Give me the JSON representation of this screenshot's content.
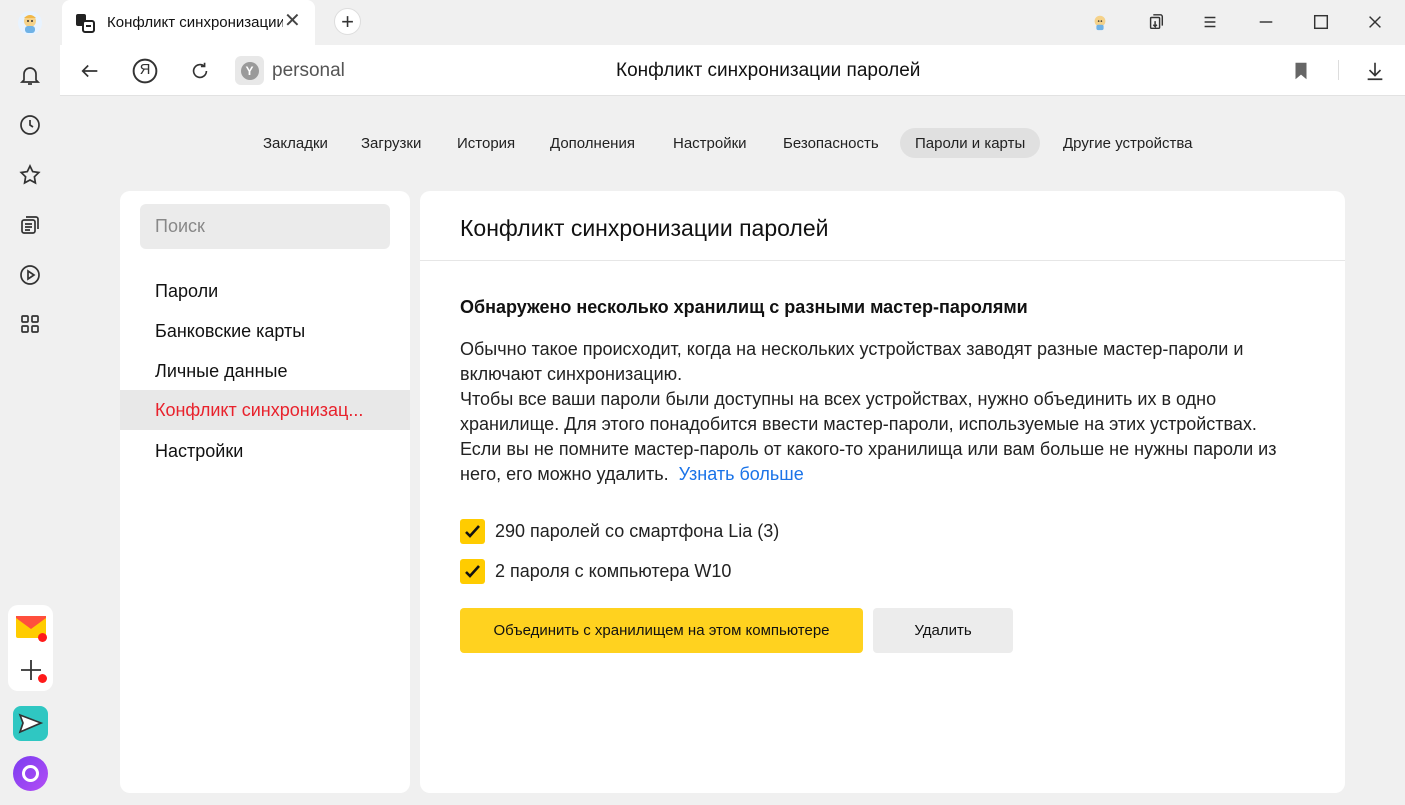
{
  "tab": {
    "title": "Конфликт синхронизации паролей",
    "close_label": "✕",
    "new_tab_label": "+"
  },
  "addressbar": {
    "url": "personal",
    "page_title": "Конфликт синхронизации паролей",
    "site_icon_letter": "Y",
    "yandex_letter": "Я"
  },
  "settings_tabs": [
    {
      "label": "Закладки"
    },
    {
      "label": "Загрузки"
    },
    {
      "label": "История"
    },
    {
      "label": "Дополнения"
    },
    {
      "label": "Настройки"
    },
    {
      "label": "Безопасность"
    },
    {
      "label": "Пароли и карты",
      "active": true
    },
    {
      "label": "Другие устройства"
    }
  ],
  "sidebar": {
    "search_placeholder": "Поиск",
    "items": [
      {
        "label": "Пароли"
      },
      {
        "label": "Банковские карты"
      },
      {
        "label": "Личные данные"
      },
      {
        "label": "Конфликт синхронизац...",
        "active": true
      },
      {
        "label": "Настройки"
      }
    ]
  },
  "main": {
    "title": "Конфликт синхронизации паролей",
    "heading": "Обнаружено несколько хранилищ с разными мастер-паролями",
    "paragraph_1": "Обычно такое происходит, когда на нескольких устройствах заводят разные мастер-пароли и включают синхронизацию.",
    "paragraph_2": "Чтобы все ваши пароли были доступны на всех устройствах, нужно объединить их в одно хранилище. Для этого понадобится ввести мастер-пароли, используемые на этих устройствах.",
    "paragraph_3": "Если вы не помните мастер-пароль от какого-то хранилища или вам больше не нужны пароли из него, его можно удалить.",
    "learn_more": "Узнать больше",
    "storages": [
      {
        "label": "290 паролей со смартфона Lia (3)",
        "checked": true
      },
      {
        "label": "2 пароля с компьютера W10",
        "checked": true
      }
    ],
    "merge_button": "Объединить с хранилищем на этом компьютере",
    "delete_button": "Удалить"
  },
  "colors": {
    "accent": "#ffcc00",
    "link": "#1a73e8",
    "active_nav": "#e8222c"
  }
}
